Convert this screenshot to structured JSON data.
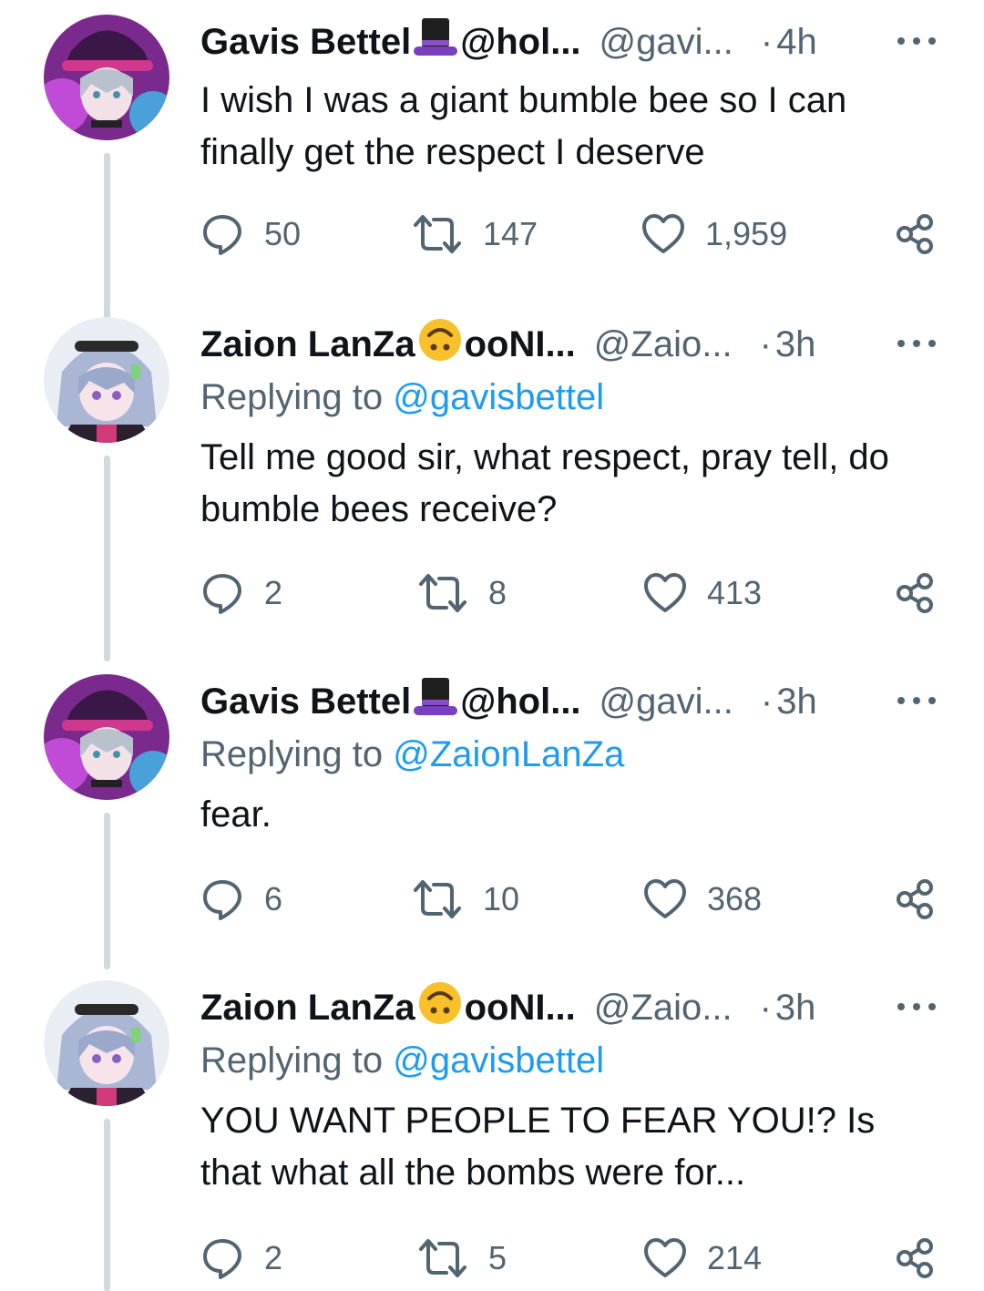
{
  "tweets": [
    {
      "name": "Gavis Bettel",
      "name_suffix": "@hol...",
      "name_emoji": "top-hat-emoji",
      "handle": "@gavi...",
      "time": "4h",
      "replying_prefix": "",
      "replying_to": "",
      "text": "I wish I was a giant bumble bee so I can finally get the respect I deserve",
      "replies": "50",
      "retweets": "147",
      "likes": "1,959",
      "avatar": "gavis-avatar"
    },
    {
      "name": "Zaion LanZa",
      "name_suffix": "ooNI...",
      "name_emoji": "upside-down-face-emoji",
      "handle": "@Zaio...",
      "time": "3h",
      "replying_prefix": "Replying to",
      "replying_to": "@gavisbettel",
      "text": "Tell me good sir, what respect, pray tell, do bumble bees receive?",
      "replies": "2",
      "retweets": "8",
      "likes": "413",
      "avatar": "zaion-avatar"
    },
    {
      "name": "Gavis Bettel",
      "name_suffix": "@hol...",
      "name_emoji": "top-hat-emoji",
      "handle": "@gavi...",
      "time": "3h",
      "replying_prefix": "Replying to",
      "replying_to": "@ZaionLanZa",
      "text": "fear.",
      "replies": "6",
      "retweets": "10",
      "likes": "368",
      "avatar": "gavis-avatar"
    },
    {
      "name": "Zaion LanZa",
      "name_suffix": "ooNI...",
      "name_emoji": "upside-down-face-emoji",
      "handle": "@Zaio...",
      "time": "3h",
      "replying_prefix": "Replying to",
      "replying_to": "@gavisbettel",
      "text": "YOU WANT PEOPLE TO FEAR YOU!? Is that what all the bombs were for...",
      "replies": "2",
      "retweets": "5",
      "likes": "214",
      "avatar": "zaion-avatar"
    }
  ],
  "colors": {
    "text": "#0f1419",
    "secondary": "#536471",
    "link": "#1d9bf0",
    "thread_line": "#cfd9de"
  }
}
